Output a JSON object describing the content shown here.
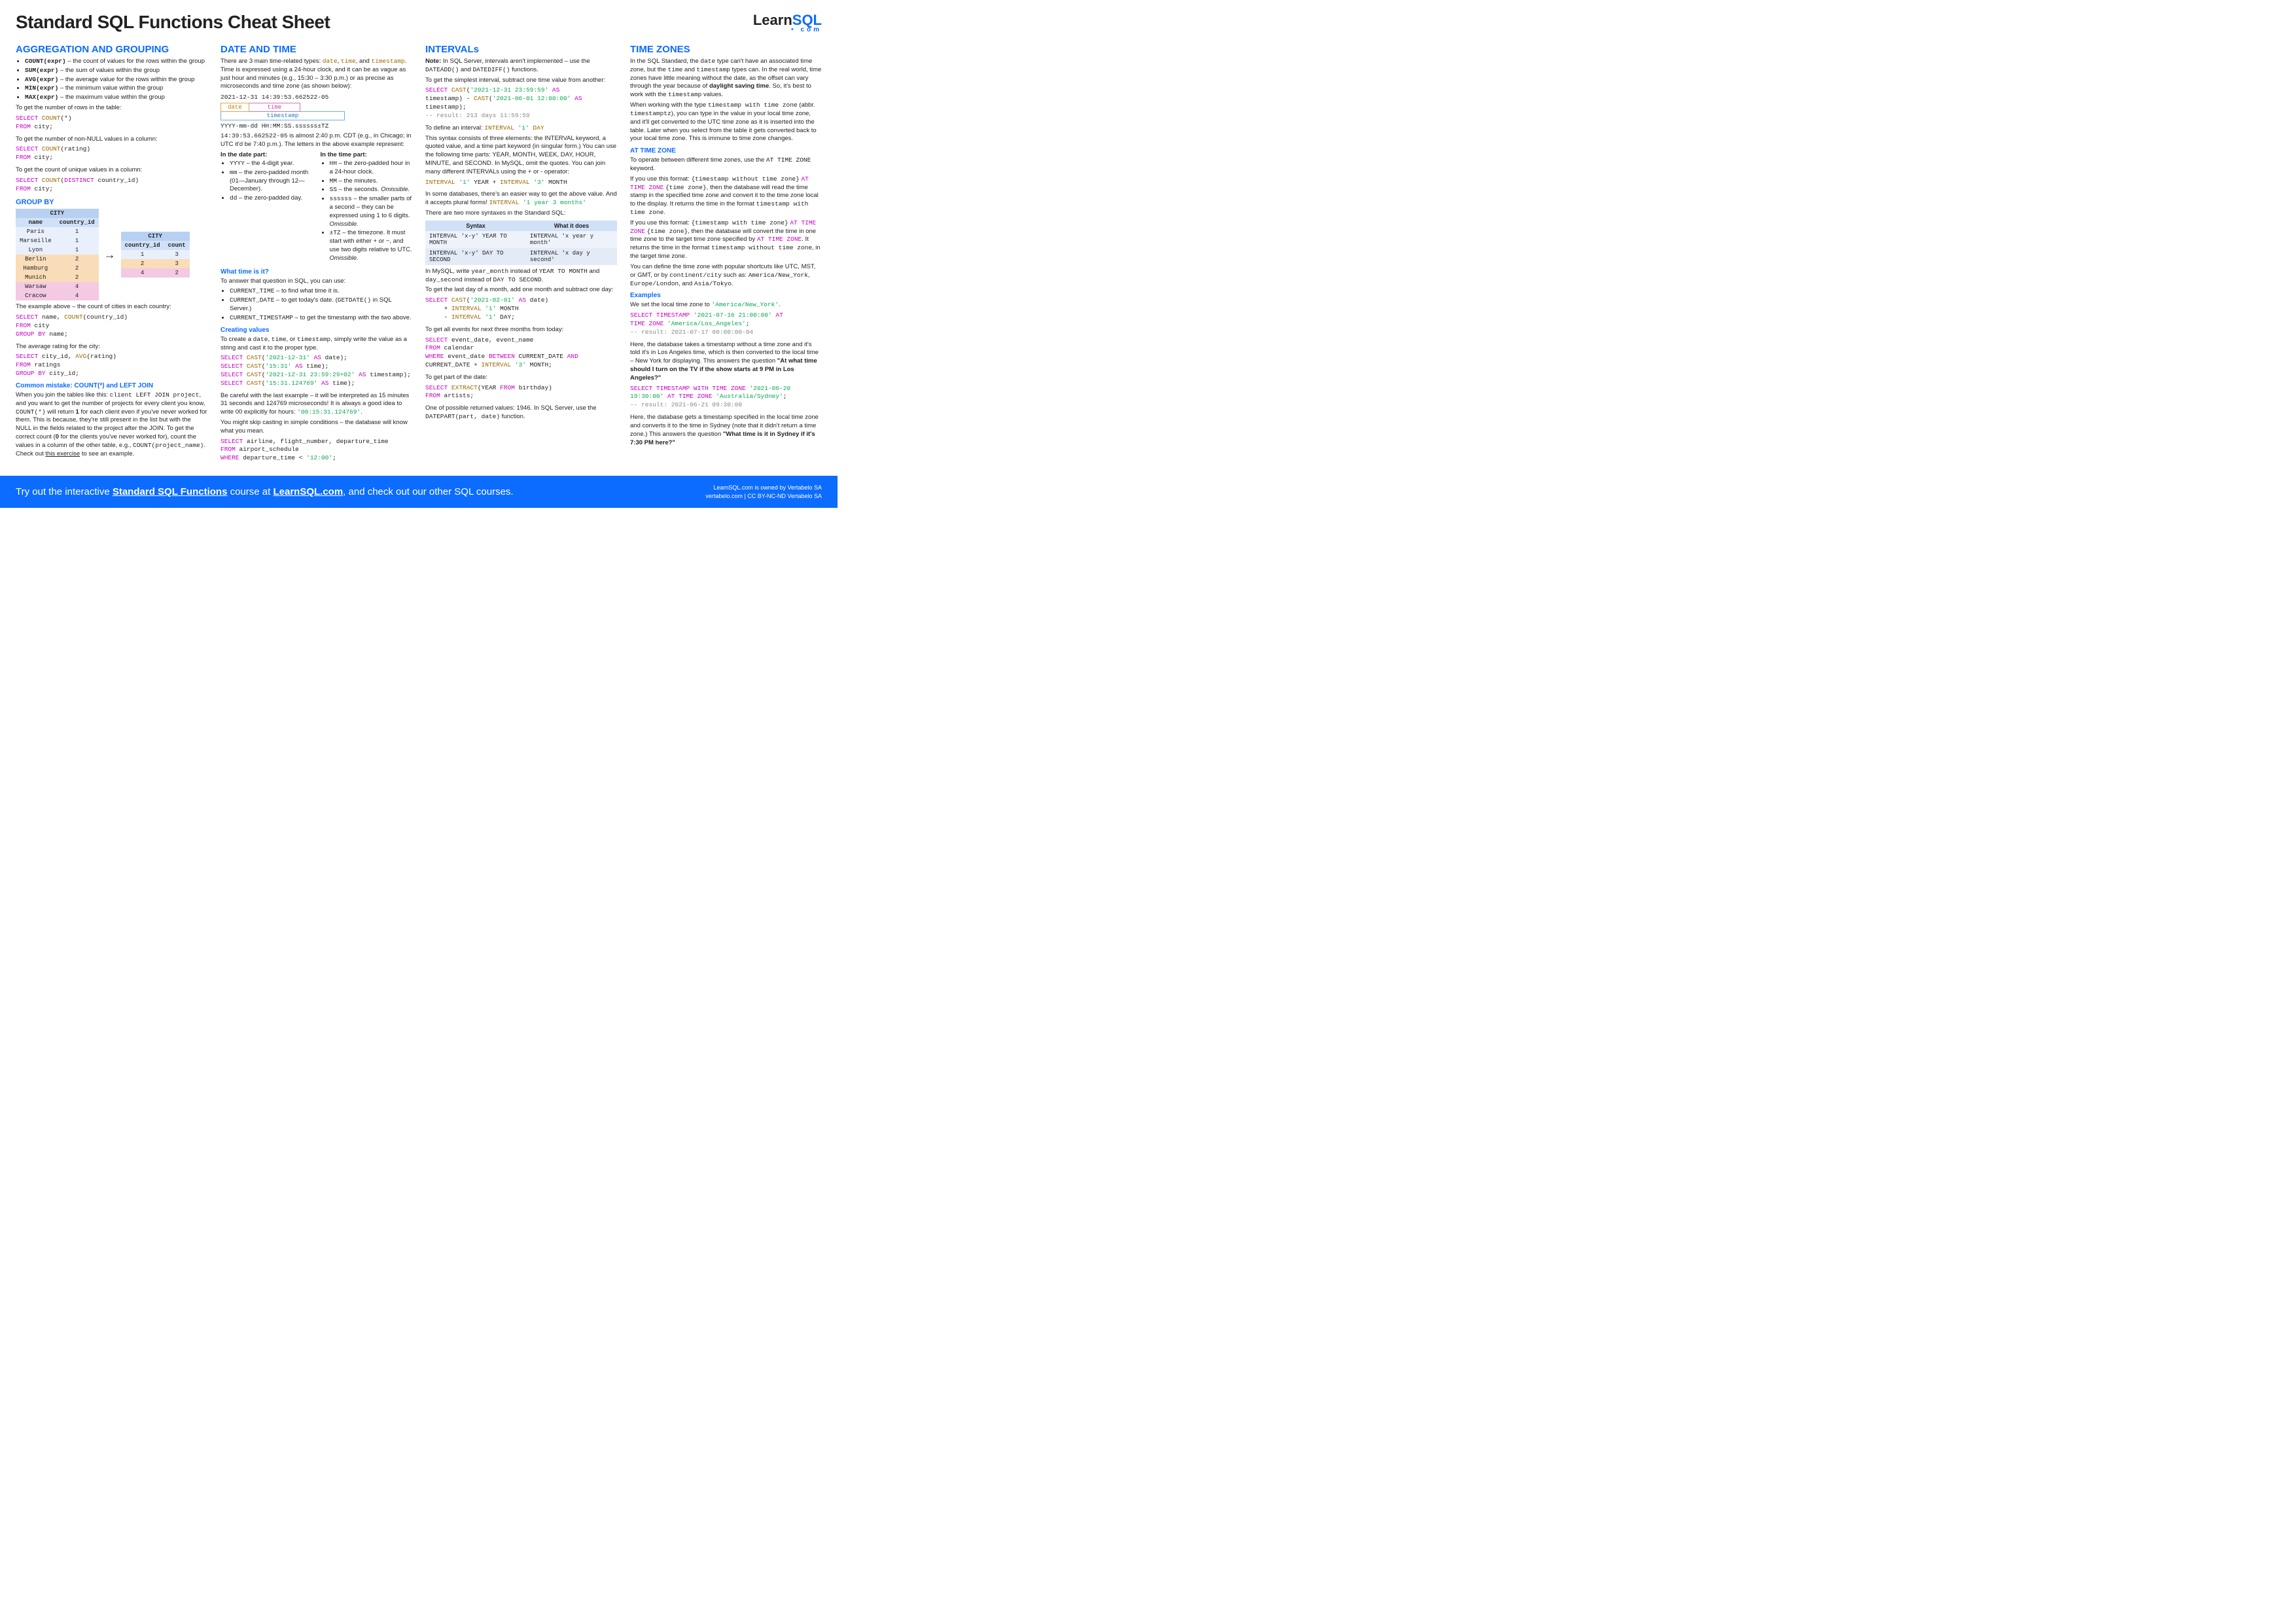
{
  "header": {
    "title": "Standard SQL Functions Cheat Sheet",
    "logo_learn": "Learn",
    "logo_sql": "SQL",
    "logo_sub": "com"
  },
  "col1": {
    "h_agg": "AGGREGATION AND GROUPING",
    "agg_items": [
      {
        "fn": "COUNT(expr)",
        "desc": " – the count of values for the rows within the group"
      },
      {
        "fn": "SUM(expr)",
        "desc": " – the sum of values within the group"
      },
      {
        "fn": "AVG(expr)",
        "desc": " – the average value for the rows within the group"
      },
      {
        "fn": "MIN(expr)",
        "desc": " – the minimum value within the group"
      },
      {
        "fn": "MAX(expr)",
        "desc": " – the maximum value within the group"
      }
    ],
    "p_rows": "To get the number of rows in the table:",
    "q_rows": "SELECT COUNT(*)\nFROM city;",
    "p_nonnull": "To get the number of non-NULL values in a column:",
    "q_nonnull": "SELECT COUNT(rating)\nFROM city;",
    "p_unique": "To get the count of unique values in a column:",
    "q_unique": "SELECT COUNT(DISTINCT country_id)\nFROM city;",
    "h_groupby": "GROUP BY",
    "tbl1_title": "CITY",
    "tbl1_head": [
      "name",
      "country_id"
    ],
    "tbl1_rows": [
      [
        "Paris",
        "1"
      ],
      [
        "Marseille",
        "1"
      ],
      [
        "Lyon",
        "1"
      ],
      [
        "Berlin",
        "2"
      ],
      [
        "Hamburg",
        "2"
      ],
      [
        "Munich",
        "2"
      ],
      [
        "Warsaw",
        "4"
      ],
      [
        "Cracow",
        "4"
      ]
    ],
    "tbl2_title": "CITY",
    "tbl2_head": [
      "country_id",
      "count"
    ],
    "tbl2_rows": [
      [
        "1",
        "3"
      ],
      [
        "2",
        "3"
      ],
      [
        "4",
        "2"
      ]
    ],
    "p_example": "The example above – the count of cities in each country:",
    "q_example": "SELECT name, COUNT(country_id)\nFROM city\nGROUP BY name;",
    "p_avg": "The average rating for the city:",
    "q_avg": "SELECT city_id, AVG(rating)\nFROM ratings\nGROUP BY city_id;",
    "h_mistake": "Common mistake: COUNT(*) and LEFT JOIN",
    "p_mistake": "When you join the tables like this: client LEFT JOIN project, and you want to get the number of projects for every client you know, COUNT(*) will return 1 for each client even if you've never worked for them. This is because, they're still present in the list but with the NULL in the fields related to the project after the JOIN. To get the correct count (0 for the clients you've never worked for), count the values in a column of the other table, e.g., COUNT(project_name). Check out this exercise to see an example."
  },
  "col2": {
    "h_date": "DATE AND TIME",
    "p_intro1": "There are 3 main time-related types: ",
    "p_intro2": ". Time is expressed using a 24-hour clock, and it can be as vague as just hour and minutes (e.g., 15:30 – 3:30 p.m.) or as precise as microseconds and time zone (as shown below):",
    "ts_val": "2021-12-31 14:39:53.662522-05",
    "ts_date": "date",
    "ts_time": "time",
    "ts_stamp": "timestamp",
    "ts_fmt": "YYYY-mm-dd HH:MM:SS.ssssss±TZ",
    "p_almost": "14:39:53.662522-05 is almost 2:40 p.m. CDT (e.g., in Chicago; in UTC it'd be 7:40 p.m.). The letters in the above example represent:",
    "h_datepart": "In the date part:",
    "date_items": [
      "YYYY – the 4-digit year.",
      "mm – the zero-padded month (01—January through 12—December).",
      "dd – the zero-padded day."
    ],
    "h_timepart": "In the time part:",
    "time_items": [
      "HH – the zero-padded hour in a 24-hour clock.",
      "MM – the minutes.",
      "SS – the seconds. Omissible.",
      "ssssss – the smaller parts of a second – they can be expressed using 1 to 6 digits. Omissible.",
      "±TZ – the timezone. It must start with either + or −, and use two digits relative to UTC. Omissible."
    ],
    "h_what": "What time is it?",
    "p_what": "To answer that question in SQL, you can use:",
    "what_items": [
      "CURRENT_TIME – to find what time it is.",
      "CURRENT_DATE – to get today's date. (GETDATE() in SQL Server.)",
      "CURRENT_TIMESTAMP – to get the timestamp with the two above."
    ],
    "h_create": "Creating values",
    "p_create": "To create a date, time, or timestamp, simply write the value as a string and cast it to the proper type.",
    "q_create": "SELECT CAST('2021-12-31' AS date);\nSELECT CAST('15:31' AS time);\nSELECT CAST('2021-12-31 23:59:29+02' AS timestamp);\nSELECT CAST('15:31.124769' AS time);",
    "p_careful": "Be careful with the last example – it will be interpreted as 15 minutes 31 seconds and 124769 microseconds! It is always a good idea to write 00 explicitly for hours: '00:15:31.124769'.",
    "p_skip": "You might skip casting in simple conditions – the database will know what you mean.",
    "q_skip": "SELECT airline, flight_number, departure_time\nFROM airport_schedule\nWHERE departure_time < '12:00';"
  },
  "col3": {
    "h_int": "INTERVALs",
    "p_note": "Note: In SQL Server, intervals aren't implemented – use the DATEADD() and DATEDIFF() functions.",
    "p_simple": "To get the simplest interval, subtract one time value from another:",
    "q_simple": "SELECT CAST('2021-12-31 23:59:59' AS timestamp) - CAST('2021-06-01 12:00:00' AS timestamp);",
    "cmt_simple": "-- result: 213 days 11:59:59",
    "p_define1": "To define an interval:  ",
    "p_define_code": "INTERVAL '1' DAY",
    "p_define2": "This syntax consists of three elements: the INTERVAL keyword, a quoted value, and a time part keyword (in singular form.) You can use the following time parts: YEAR, MONTH, WEEK, DAY, HOUR, MINUTE, and SECOND. In MySQL, omit the quotes. You can join many different INTERVALs using the + or - operator:",
    "q_join": "INTERVAL '1' YEAR + INTERVAL '3' MONTH",
    "p_easier1": "In some databases, there's an easier way to get the above value. And it accepts plural forms!  ",
    "p_easier_code": "INTERVAL '1 year 3 months'",
    "p_easier2": "There are two more syntaxes in the Standard SQL:",
    "tbl_head": [
      "Syntax",
      "What it does"
    ],
    "tbl_rows": [
      [
        "INTERVAL 'x-y' YEAR TO MONTH",
        "INTERVAL 'x year y month'"
      ],
      [
        "INTERVAL 'x-y' DAY TO SECOND",
        "INTERVAL 'x day y second'"
      ]
    ],
    "p_mysql": "In MySQL, write year_month instead of YEAR TO MONTH and day_second instead of DAY TO SECOND.",
    "p_lastday": "To get the last day of a month, add one month and subtract one day:",
    "q_lastday": "SELECT CAST('2021-02-01' AS date)\n     + INTERVAL '1' MONTH\n     - INTERVAL '1' DAY;",
    "p_events": "To get all events for next three months from today:",
    "q_events": "SELECT event_date, event_name\nFROM calendar\nWHERE event_date BETWEEN CURRENT_DATE AND CURRENT_DATE + INTERVAL '3' MONTH;",
    "p_part": "To get part of the date:",
    "q_part": "SELECT EXTRACT(YEAR FROM birthday)\nFROM artists;",
    "p_part2": "One of possible returned values: 1946. In SQL Server, use the DATEPART(part, date) function."
  },
  "col4": {
    "h_tz": "TIME ZONES",
    "p1": "In the SQL Standard, the date type can't have an associated time zone, but the time and timestamp types can. In the real world, time zones have little meaning without the date, as the offset can vary through the year because of daylight saving time. So, it's best to work with the timestamp values.",
    "p2": "When working with the type timestamp with time zone (abbr. timestamptz), you can type in the value in your local time zone, and it'll get converted to the UTC time zone as it is inserted into the table. Later when you select from the table it gets converted back to your local time zone. This is immune to time zone changes.",
    "h_atz": "AT TIME ZONE",
    "p_atz1": "To operate between different time zones, use the AT TIME ZONE keyword.",
    "p_atz2": "If you use this format: {timestamp without time zone} AT TIME ZONE {time zone}, then the database will read the time stamp in the specified time zone and convert it to the time zone local to the display. It returns the time in the format timestamp with time zone.",
    "p_atz3": "If you use this format: {timestamp with time zone} AT TIME ZONE {time zone}, then the database will convert the time in one time zone to the target time zone specified by AT TIME ZONE. It returns the time in the format timestamp without time zone, in the target time zone.",
    "p_atz4": "You can define the time zone with popular shortcuts like UTC, MST, or GMT, or by continent/city such as: America/New_York, Europe/London, and Asia/Tokyo.",
    "h_ex": "Examples",
    "p_set": "We set the local time zone to 'America/New_York'.",
    "q_ex1": "SELECT TIMESTAMP '2021-07-16 21:00:00' AT TIME ZONE 'America/Los_Angeles';",
    "cmt_ex1": "-- result: 2021-07-17 00:00:00-04",
    "p_ex1": "Here, the database takes a timestamp without a time zone and it's told it's in Los Angeles time, which is then converted to the local time – New York for displaying. This answers the question \"At what time should I turn on the TV if the show starts at 9 PM in Los Angeles?\"",
    "q_ex2": "SELECT TIMESTAMP WITH TIME ZONE '2021-06-20 19:30:00' AT TIME ZONE 'Australia/Sydney';",
    "cmt_ex2": "-- result: 2021-06-21 09:30:00",
    "p_ex2": "Here, the database gets a timestamp specified in the local time zone and converts it to the time in Sydney (note that it didn't return a time zone.) This answers the question \"What time is it in Sydney if it's 7:30 PM here?\""
  },
  "footer": {
    "left_pre": "Try out the interactive ",
    "link1": "Standard SQL Functions",
    "mid": " course at ",
    "link2": "LearnSQL.com",
    "post": ", and check out our other SQL courses.",
    "r1": "LearnSQL.com is owned by Vertabelo SA",
    "r2": "vertabelo.com | CC BY-NC-ND Vertabelo SA"
  }
}
